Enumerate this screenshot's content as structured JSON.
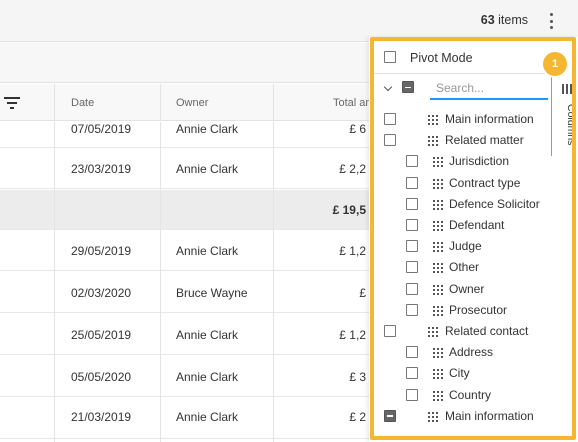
{
  "toolbar": {
    "count": "63",
    "count_suffix": " items"
  },
  "grid": {
    "headers": {
      "date": "Date",
      "owner": "Owner",
      "total": "Total am"
    },
    "rows": [
      {
        "date": "07/05/2019",
        "owner": "Annie Clark",
        "amount": "£ 6"
      },
      {
        "date": "23/03/2019",
        "owner": "Annie Clark",
        "amount": "£ 2,2"
      },
      {
        "group_total": "£ 19,5"
      },
      {
        "date": "29/05/2019",
        "owner": "Annie Clark",
        "amount": "£ 1,2"
      },
      {
        "date": "02/03/2020",
        "owner": "Bruce Wayne",
        "amount": "£"
      },
      {
        "date": "25/05/2019",
        "owner": "Annie Clark",
        "amount": "£ 1,2"
      },
      {
        "date": "05/05/2020",
        "owner": "Annie Clark",
        "amount": "£ 3"
      },
      {
        "date": "21/03/2019",
        "owner": "Annie Clark",
        "amount": "£ 2"
      }
    ]
  },
  "tool_panel": {
    "pivot_mode_label": "Pivot Mode",
    "search_placeholder": "Search...",
    "side_tab_label": "Columns",
    "badge": "1",
    "tree": [
      {
        "label": "Main information",
        "level": 0,
        "expandable": true,
        "checkbox": "unchecked"
      },
      {
        "label": "Related matter",
        "level": 0,
        "expandable": true,
        "checkbox": "unchecked"
      },
      {
        "label": "Jurisdiction",
        "level": 1,
        "checkbox": "unchecked"
      },
      {
        "label": "Contract type",
        "level": 1,
        "checkbox": "unchecked"
      },
      {
        "label": "Defence Solicitor",
        "level": 1,
        "checkbox": "unchecked"
      },
      {
        "label": "Defendant",
        "level": 1,
        "checkbox": "unchecked"
      },
      {
        "label": "Judge",
        "level": 1,
        "checkbox": "unchecked"
      },
      {
        "label": "Other",
        "level": 1,
        "checkbox": "unchecked"
      },
      {
        "label": "Owner",
        "level": 1,
        "checkbox": "unchecked"
      },
      {
        "label": "Prosecutor",
        "level": 1,
        "checkbox": "unchecked"
      },
      {
        "label": "Related contact",
        "level": 0,
        "expandable": true,
        "checkbox": "unchecked"
      },
      {
        "label": "Address",
        "level": 1,
        "checkbox": "unchecked"
      },
      {
        "label": "City",
        "level": 1,
        "checkbox": "unchecked"
      },
      {
        "label": "Country",
        "level": 1,
        "checkbox": "unchecked"
      },
      {
        "label": "Main information",
        "level": 0,
        "expandable": true,
        "checkbox": "indeterminate"
      }
    ]
  },
  "colors": {
    "highlight": "#f5b731",
    "search_underline": "#2196f3",
    "group_row_bg": "#ececec"
  },
  "icons": {
    "filter": "filter-icon",
    "menu": "kebab-menu-icon",
    "drag": "drag-grip-icon",
    "expand": "chevron-down-icon",
    "columns": "columns-icon"
  }
}
